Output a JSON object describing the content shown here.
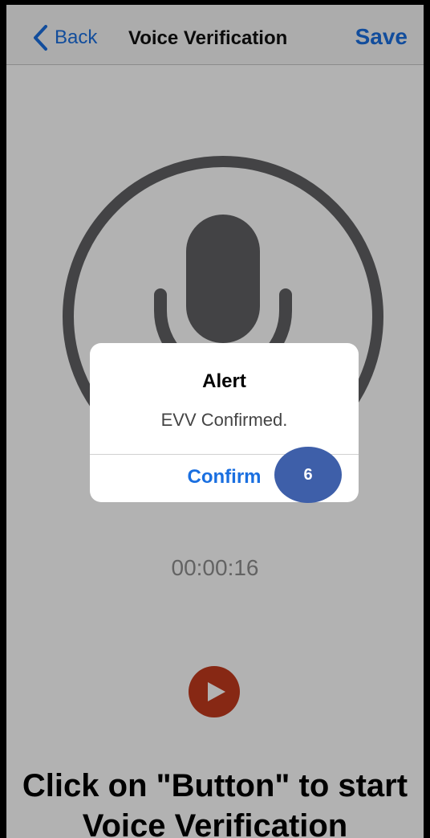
{
  "navbar": {
    "back_label": "Back",
    "title": "Voice Verification",
    "save_label": "Save"
  },
  "main": {
    "timer": "00:00:16",
    "instruction_line1": "Click on \"Button\" to start",
    "instruction_line2": "Voice Verification"
  },
  "alert": {
    "title": "Alert",
    "message": "EVV Confirmed.",
    "confirm_label": "Confirm"
  },
  "step_badge": "6",
  "colors": {
    "accent": "#1a6fe0",
    "play_button": "#c23a1e",
    "mic": "#606163",
    "badge": "#3e5fa9"
  },
  "icons": {
    "back": "chevron-left-icon",
    "microphone": "microphone-icon",
    "play": "play-icon"
  }
}
